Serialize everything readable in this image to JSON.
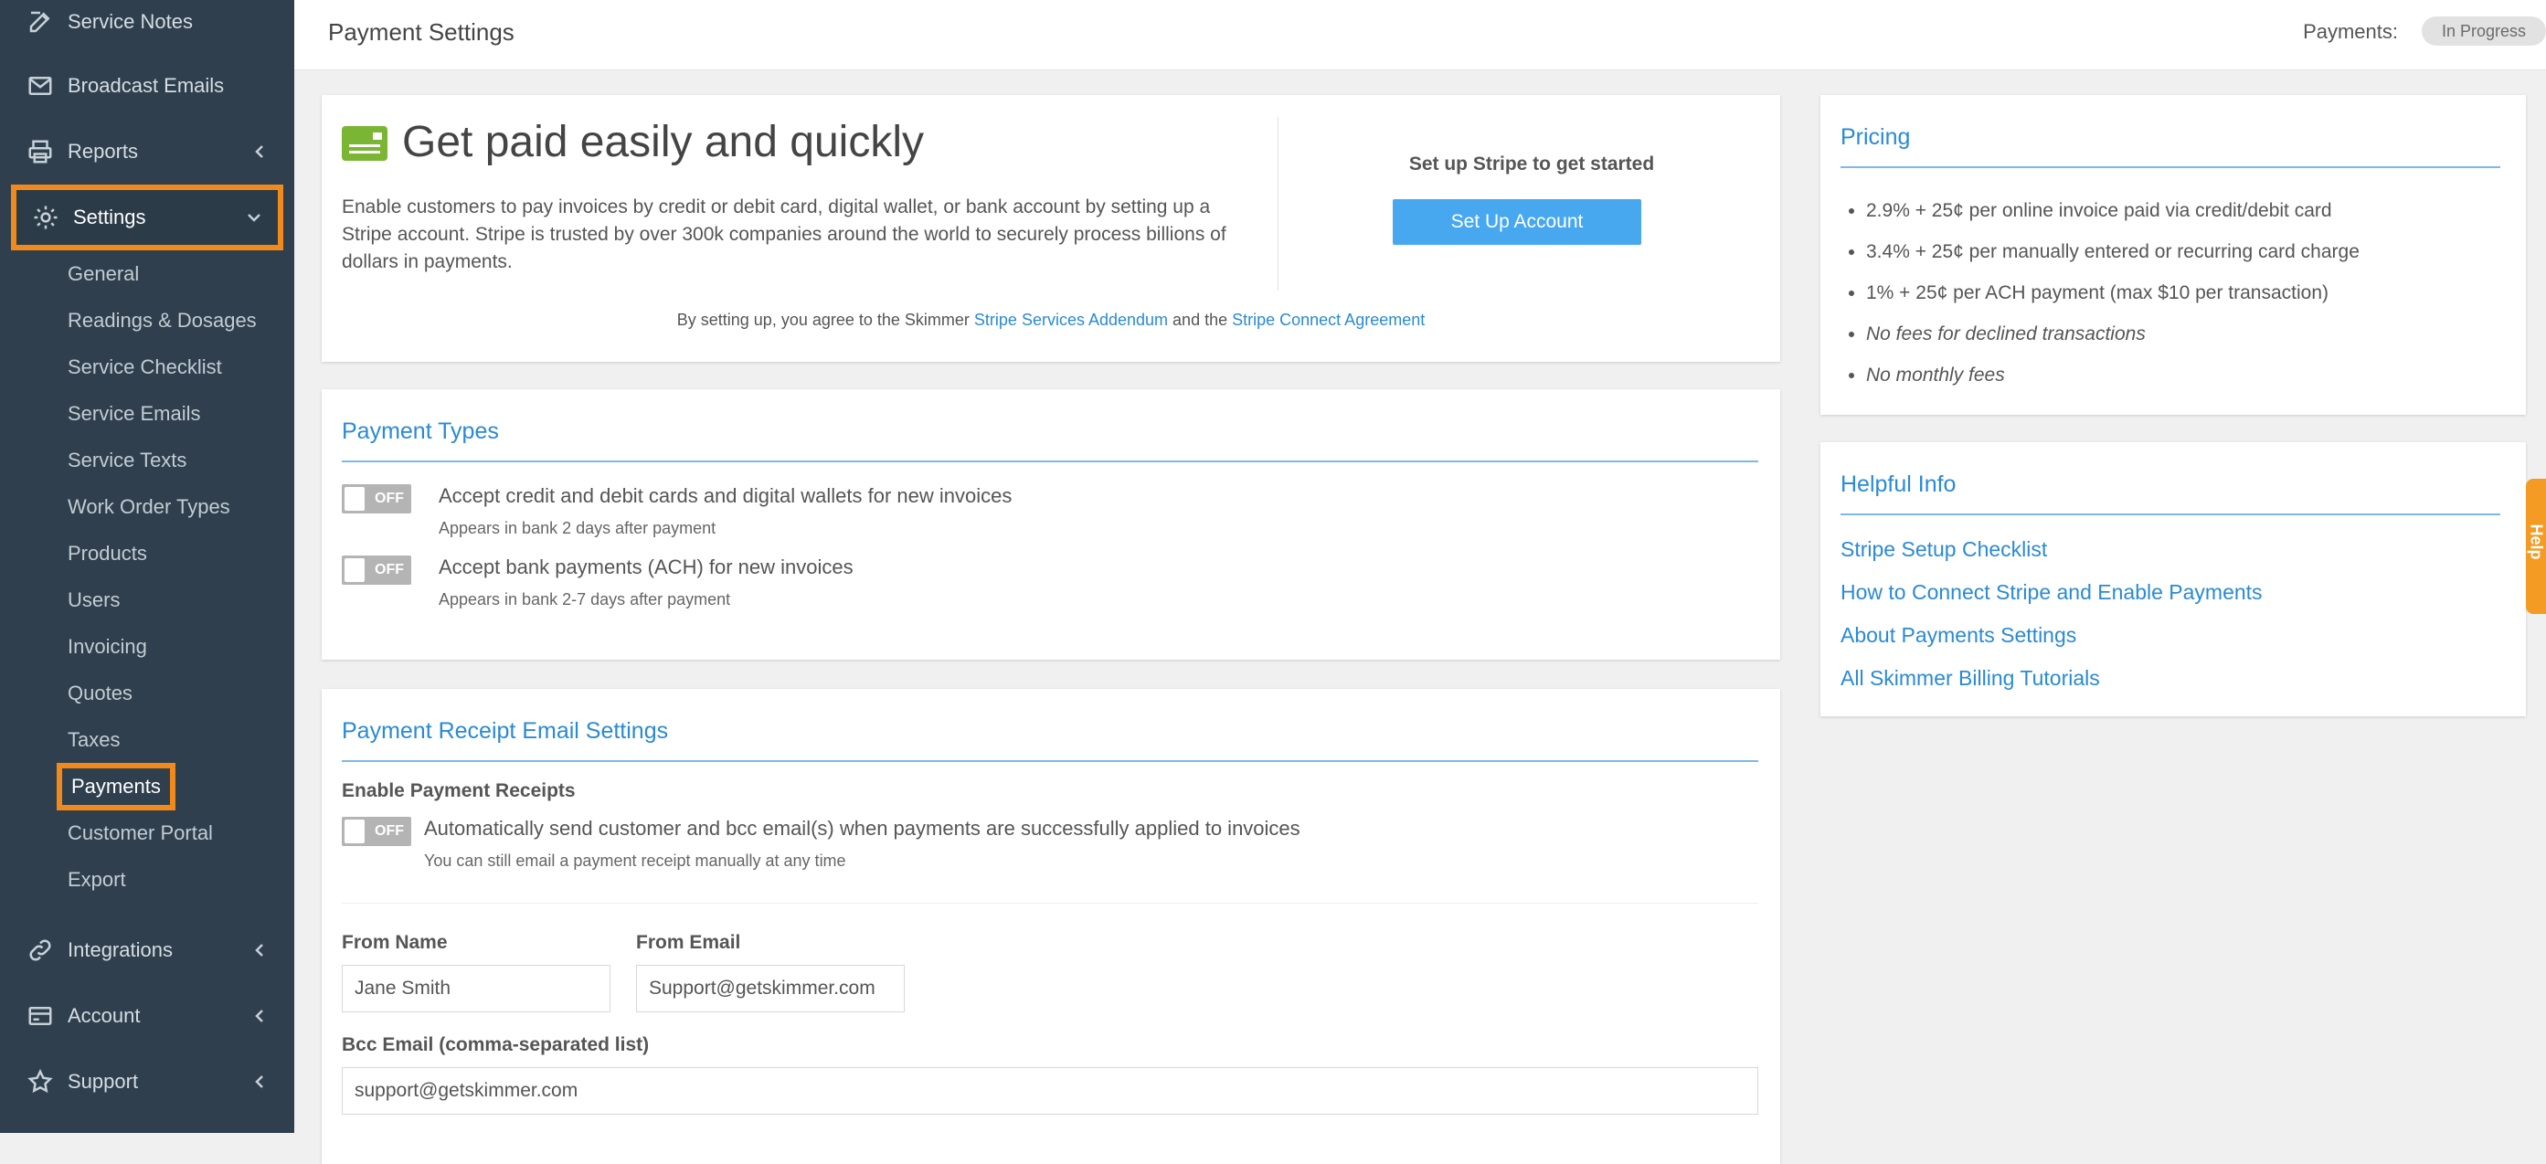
{
  "sidebar": {
    "items": [
      {
        "label": "Service Notes",
        "icon": "edit-icon"
      },
      {
        "label": "Broadcast Emails",
        "icon": "mail-icon"
      },
      {
        "label": "Reports",
        "icon": "printer-icon"
      },
      {
        "label": "Settings",
        "icon": "gear-icon"
      },
      {
        "label": "Integrations",
        "icon": "link-icon"
      },
      {
        "label": "Account",
        "icon": "card-icon"
      },
      {
        "label": "Support",
        "icon": "star-icon"
      }
    ],
    "settings_sub": [
      "General",
      "Readings & Dosages",
      "Service Checklist",
      "Service Emails",
      "Service Texts",
      "Work Order Types",
      "Products",
      "Users",
      "Invoicing",
      "Quotes",
      "Taxes",
      "Payments",
      "Customer Portal",
      "Export"
    ]
  },
  "header": {
    "title": "Payment Settings",
    "payments_label": "Payments:",
    "status": "In Progress"
  },
  "hero": {
    "title": "Get paid easily and quickly",
    "description": "Enable customers to pay invoices by credit or debit card, digital wallet, or bank account by setting up a Stripe account. Stripe is trusted by over 300k companies around the world to securely process billions of dollars in payments.",
    "setup_heading": "Set up Stripe to get started",
    "setup_button": "Set Up Account",
    "agree_prefix": "By setting up, you agree to the Skimmer ",
    "agree_link1": "Stripe Services Addendum",
    "agree_mid": " and the ",
    "agree_link2": "Stripe Connect Agreement"
  },
  "payment_types": {
    "title": "Payment Types",
    "toggle_text": "OFF",
    "options": [
      {
        "title": "Accept credit and debit cards and digital wallets for new invoices",
        "sub": "Appears in bank 2 days after payment"
      },
      {
        "title": "Accept bank payments (ACH) for new invoices",
        "sub": "Appears in bank 2-7 days after payment"
      }
    ]
  },
  "receipts": {
    "title": "Payment Receipt Email Settings",
    "enable_label": "Enable Payment Receipts",
    "toggle_text": "OFF",
    "option_title": "Automatically send customer and bcc email(s) when payments are successfully applied to invoices",
    "option_sub": "You can still email a payment receipt manually at any time",
    "from_name_label": "From Name",
    "from_name_value": "Jane Smith",
    "from_email_label": "From Email",
    "from_email_value": "Support@getskimmer.com",
    "bcc_label": "Bcc Email (comma-separated list)",
    "bcc_value": "support@getskimmer.com"
  },
  "pricing": {
    "title": "Pricing",
    "items": [
      "2.9% + 25¢ per online invoice paid via credit/debit card",
      "3.4% + 25¢ per manually entered or recurring card charge",
      "1% + 25¢ per ACH payment (max $10 per transaction)",
      "No fees for declined transactions",
      "No monthly fees"
    ]
  },
  "helpful": {
    "title": "Helpful Info",
    "links": [
      "Stripe Setup Checklist",
      "How to Connect Stripe and Enable Payments",
      "About Payments Settings",
      "All Skimmer Billing Tutorials"
    ]
  },
  "help_tab": "Help",
  "colors": {
    "sidebar": "#2f3f4d",
    "accent": "#2a8ad4",
    "highlight": "#f08a1c",
    "button": "#47a8f0"
  }
}
